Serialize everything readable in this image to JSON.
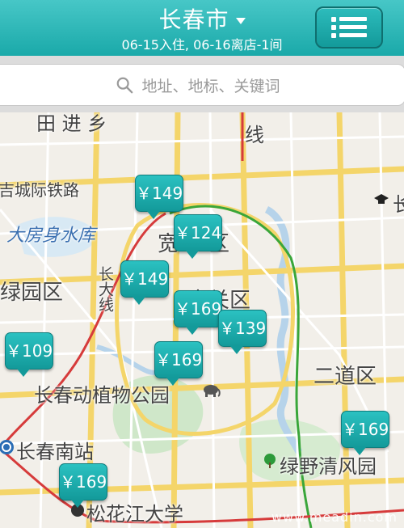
{
  "header": {
    "city": "长春市",
    "subtitle": "06-15入住, 06-16离店-1间"
  },
  "search": {
    "placeholder": "地址、地标、关键词"
  },
  "map": {
    "labels": {
      "top_left": "田 进 乡",
      "railway": "吉城际铁路",
      "reservoir": "大房身水库",
      "lvyuan": "绿园区",
      "kuan": "宽",
      "qu_char": "区",
      "nan_guan": "南关区",
      "chang_da": "长大线",
      "erdao": "二道区",
      "zoo": "长春动植物公园",
      "south_station": "长春南站",
      "lvye": "绿野清风园",
      "university": "松花江大学",
      "top_line": "线",
      "right_cut": "长"
    },
    "prices": [
      "￥149",
      "￥124",
      "￥149",
      "￥169",
      "￥139",
      "￥109",
      "￥169",
      "￥169",
      "￥169"
    ]
  },
  "watermark": "www.meadin.com",
  "colors": {
    "header": "#1aa9a9",
    "pin": "#139a9a"
  }
}
